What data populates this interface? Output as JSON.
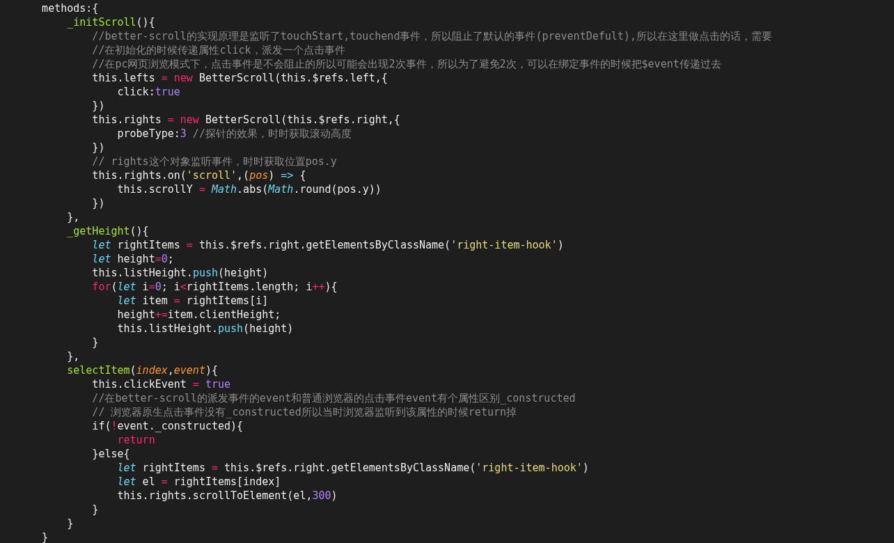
{
  "code_lines": [
    {
      "tokens": [
        {
          "kind": "plain",
          "text": "    methods:{"
        }
      ]
    },
    {
      "tokens": [
        {
          "kind": "function",
          "text": "        _initScroll"
        },
        {
          "kind": "plain",
          "text": "(){"
        }
      ]
    },
    {
      "tokens": [
        {
          "kind": "comment",
          "text": "            //better-scroll的实现原理是监听了touchStart,touchend事件，所以阻止了默认的事件(preventDefult),所以在这里做点击的话，需要"
        }
      ]
    },
    {
      "tokens": [
        {
          "kind": "comment",
          "text": "            //在初始化的时候传递属性click，派发一个点击事件"
        }
      ]
    },
    {
      "tokens": [
        {
          "kind": "comment",
          "text": "            //在pc网页浏览模式下，点击事件是不会阻止的所以可能会出现2次事件，所以为了避免2次，可以在绑定事件的时候把$event传递过去"
        }
      ]
    },
    {
      "tokens": [
        {
          "kind": "plain",
          "text": "            this.lefts "
        },
        {
          "kind": "keyword",
          "text": "= new"
        },
        {
          "kind": "plain",
          "text": " BetterScroll(this.$refs.left,{"
        }
      ]
    },
    {
      "tokens": [
        {
          "kind": "plain",
          "text": "                click:"
        },
        {
          "kind": "number",
          "text": "true"
        }
      ]
    },
    {
      "tokens": [
        {
          "kind": "plain",
          "text": "            })"
        }
      ]
    },
    {
      "tokens": [
        {
          "kind": "plain",
          "text": "            this.rights "
        },
        {
          "kind": "keyword",
          "text": "= new"
        },
        {
          "kind": "plain",
          "text": " BetterScroll(this.$refs.right,{"
        }
      ]
    },
    {
      "tokens": [
        {
          "kind": "plain",
          "text": "                probeType:"
        },
        {
          "kind": "number",
          "text": "3"
        },
        {
          "kind": "comment",
          "text": " //探针的效果，时时获取滚动高度"
        }
      ]
    },
    {
      "tokens": [
        {
          "kind": "plain",
          "text": "            })"
        }
      ]
    },
    {
      "tokens": [
        {
          "kind": "comment",
          "text": "            // rights这个对象监听事件，时时获取位置pos.y"
        }
      ]
    },
    {
      "tokens": [
        {
          "kind": "plain",
          "text": "            this.rights.on("
        },
        {
          "kind": "string",
          "text": "'scroll'"
        },
        {
          "kind": "plain",
          "text": ",("
        },
        {
          "kind": "param",
          "text": "pos"
        },
        {
          "kind": "plain",
          "text": ") "
        },
        {
          "kind": "arrow",
          "text": "=>"
        },
        {
          "kind": "plain",
          "text": " {"
        }
      ]
    },
    {
      "tokens": [
        {
          "kind": "plain",
          "text": "                this.scrollY "
        },
        {
          "kind": "keyword",
          "text": "= "
        },
        {
          "kind": "builtin",
          "text": "Math"
        },
        {
          "kind": "plain",
          "text": ".abs("
        },
        {
          "kind": "builtin",
          "text": "Math"
        },
        {
          "kind": "plain",
          "text": ".round(pos.y))"
        }
      ]
    },
    {
      "tokens": [
        {
          "kind": "plain",
          "text": "            })"
        }
      ]
    },
    {
      "tokens": [
        {
          "kind": "plain",
          "text": "        },"
        }
      ]
    },
    {
      "tokens": [
        {
          "kind": "function",
          "text": "        _getHeight"
        },
        {
          "kind": "plain",
          "text": "(){"
        }
      ]
    },
    {
      "tokens": [
        {
          "kind": "storage",
          "text": "            let"
        },
        {
          "kind": "plain",
          "text": " rightItems "
        },
        {
          "kind": "keyword",
          "text": "="
        },
        {
          "kind": "plain",
          "text": " this.$refs.right.getElementsByClassName("
        },
        {
          "kind": "string",
          "text": "'right-item-hook'"
        },
        {
          "kind": "plain",
          "text": ")"
        }
      ]
    },
    {
      "tokens": [
        {
          "kind": "storage",
          "text": "            let"
        },
        {
          "kind": "plain",
          "text": " height"
        },
        {
          "kind": "keyword",
          "text": "="
        },
        {
          "kind": "number",
          "text": "0"
        },
        {
          "kind": "plain",
          "text": ";"
        }
      ]
    },
    {
      "tokens": [
        {
          "kind": "plain",
          "text": "            this.listHeight."
        },
        {
          "kind": "method",
          "text": "push"
        },
        {
          "kind": "plain",
          "text": "(height)"
        }
      ]
    },
    {
      "tokens": [
        {
          "kind": "keyword",
          "text": "            for"
        },
        {
          "kind": "plain",
          "text": "("
        },
        {
          "kind": "storage",
          "text": "let"
        },
        {
          "kind": "plain",
          "text": " i"
        },
        {
          "kind": "keyword",
          "text": "="
        },
        {
          "kind": "number",
          "text": "0"
        },
        {
          "kind": "plain",
          "text": "; i"
        },
        {
          "kind": "keyword",
          "text": "<"
        },
        {
          "kind": "plain",
          "text": "rightItems.length; i"
        },
        {
          "kind": "keyword",
          "text": "++"
        },
        {
          "kind": "plain",
          "text": "){"
        }
      ]
    },
    {
      "tokens": [
        {
          "kind": "storage",
          "text": "                let"
        },
        {
          "kind": "plain",
          "text": " item "
        },
        {
          "kind": "keyword",
          "text": "="
        },
        {
          "kind": "plain",
          "text": " rightItems[i]"
        }
      ]
    },
    {
      "tokens": [
        {
          "kind": "plain",
          "text": "                height"
        },
        {
          "kind": "keyword",
          "text": "+="
        },
        {
          "kind": "plain",
          "text": "item.clientHeight;"
        }
      ]
    },
    {
      "tokens": [
        {
          "kind": "plain",
          "text": "                this.listHeight."
        },
        {
          "kind": "method",
          "text": "push"
        },
        {
          "kind": "plain",
          "text": "(height)"
        }
      ]
    },
    {
      "tokens": [
        {
          "kind": "plain",
          "text": "            }"
        }
      ]
    },
    {
      "tokens": [
        {
          "kind": "plain",
          "text": "        },"
        }
      ]
    },
    {
      "tokens": [
        {
          "kind": "function",
          "text": "        selectItem"
        },
        {
          "kind": "plain",
          "text": "("
        },
        {
          "kind": "param",
          "text": "index"
        },
        {
          "kind": "plain",
          "text": ","
        },
        {
          "kind": "param",
          "text": "event"
        },
        {
          "kind": "plain",
          "text": "){"
        }
      ]
    },
    {
      "tokens": [
        {
          "kind": "plain",
          "text": "            this.clickEvent "
        },
        {
          "kind": "keyword",
          "text": "= "
        },
        {
          "kind": "number",
          "text": "true"
        }
      ]
    },
    {
      "tokens": [
        {
          "kind": "comment",
          "text": "            //在better-scroll的派发事件的event和普通浏览器的点击事件event有个属性区别_constructed"
        }
      ]
    },
    {
      "tokens": [
        {
          "kind": "comment",
          "text": "            // 浏览器原生点击事件没有_constructed所以当时浏览器监听到该属性的时候return掉"
        }
      ]
    },
    {
      "tokens": [
        {
          "kind": "plain",
          "text": "            if("
        },
        {
          "kind": "keyword",
          "text": "!"
        },
        {
          "kind": "plain",
          "text": "event._constructed){"
        }
      ]
    },
    {
      "tokens": [
        {
          "kind": "keyword",
          "text": "                return"
        }
      ]
    },
    {
      "tokens": [
        {
          "kind": "plain",
          "text": "            }else{"
        }
      ]
    },
    {
      "tokens": [
        {
          "kind": "storage",
          "text": "                let"
        },
        {
          "kind": "plain",
          "text": " rightItems "
        },
        {
          "kind": "keyword",
          "text": "="
        },
        {
          "kind": "plain",
          "text": " this.$refs.right.getElementsByClassName("
        },
        {
          "kind": "string",
          "text": "'right-item-hook'"
        },
        {
          "kind": "plain",
          "text": ")"
        }
      ]
    },
    {
      "tokens": [
        {
          "kind": "storage",
          "text": "                let"
        },
        {
          "kind": "plain",
          "text": " el "
        },
        {
          "kind": "keyword",
          "text": "="
        },
        {
          "kind": "plain",
          "text": " rightItems[index]"
        }
      ]
    },
    {
      "tokens": [
        {
          "kind": "plain",
          "text": "                this.rights.scrollToElement(el,"
        },
        {
          "kind": "number",
          "text": "300"
        },
        {
          "kind": "plain",
          "text": ")"
        }
      ]
    },
    {
      "tokens": [
        {
          "kind": "plain",
          "text": "            }"
        }
      ]
    },
    {
      "tokens": [
        {
          "kind": "plain",
          "text": "        }"
        }
      ]
    },
    {
      "tokens": [
        {
          "kind": "plain",
          "text": "    }"
        }
      ]
    }
  ]
}
